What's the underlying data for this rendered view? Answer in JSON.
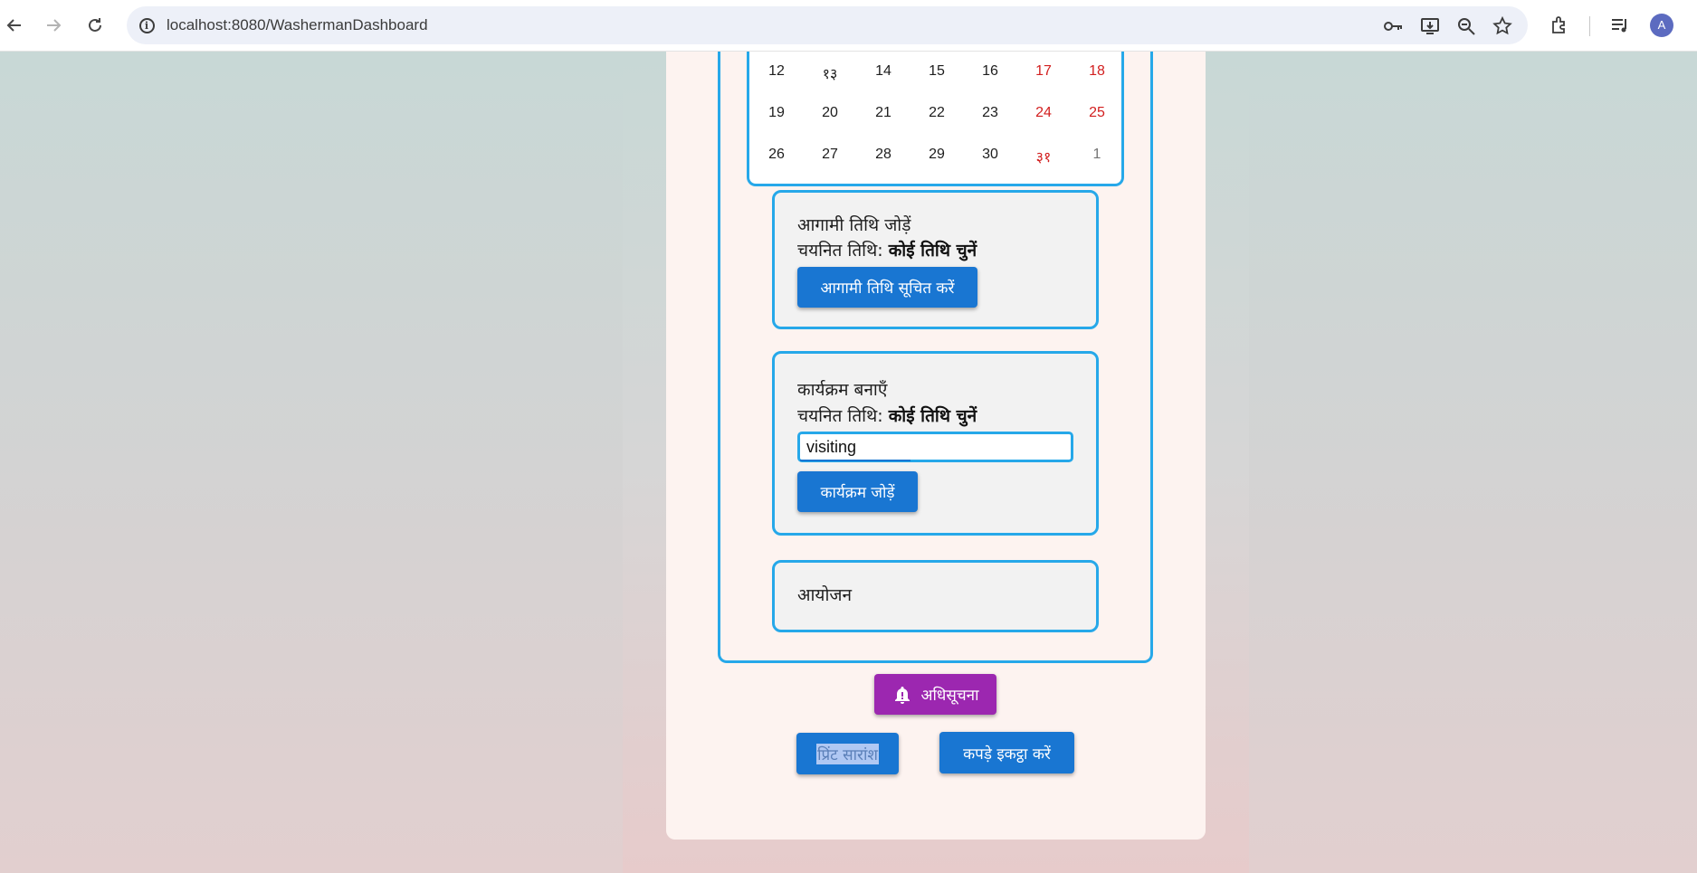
{
  "browser": {
    "url": "localhost:8080/WashermanDashboard",
    "avatar_letter": "A"
  },
  "calendar": {
    "rows": [
      [
        {
          "day": "12",
          "kind": "normal"
        },
        {
          "day": "१३",
          "kind": "normal"
        },
        {
          "day": "14",
          "kind": "normal"
        },
        {
          "day": "15",
          "kind": "normal"
        },
        {
          "day": "16",
          "kind": "normal"
        },
        {
          "day": "17",
          "kind": "weekend"
        },
        {
          "day": "18",
          "kind": "weekend"
        }
      ],
      [
        {
          "day": "19",
          "kind": "normal"
        },
        {
          "day": "20",
          "kind": "normal"
        },
        {
          "day": "21",
          "kind": "normal"
        },
        {
          "day": "22",
          "kind": "normal"
        },
        {
          "day": "23",
          "kind": "normal"
        },
        {
          "day": "24",
          "kind": "weekend"
        },
        {
          "day": "25",
          "kind": "weekend"
        }
      ],
      [
        {
          "day": "26",
          "kind": "normal"
        },
        {
          "day": "27",
          "kind": "normal"
        },
        {
          "day": "28",
          "kind": "normal"
        },
        {
          "day": "29",
          "kind": "normal"
        },
        {
          "day": "30",
          "kind": "normal"
        },
        {
          "day": "३१",
          "kind": "weekend"
        },
        {
          "day": "1",
          "kind": "muted"
        }
      ]
    ]
  },
  "upcoming_panel": {
    "title": "आगामी तिथि जोड़ें",
    "selected_label": "चयनित तिथि:",
    "selected_value": "कोई तिथि चुनें",
    "button_label": "आगामी तिथि सूचित करें"
  },
  "program_panel": {
    "title": "कार्यक्रम बनाएँ",
    "selected_label": "चयनित तिथि:",
    "selected_value": "कोई तिथि चुनें",
    "input_value": "visiting",
    "button_label": "कार्यक्रम जोड़ें"
  },
  "events_panel": {
    "title": "आयोजन"
  },
  "actions": {
    "notification_label": "अधिसूचना",
    "print_summary_label": "प्रिंट सारांश",
    "collect_clothes_label": "कपड़े इकट्ठा करें"
  },
  "colors": {
    "accent_blue": "#1976d2",
    "border_blue": "#26a8e9",
    "notification_purple": "#9c27b0",
    "weekend_red": "#d21f1f"
  }
}
